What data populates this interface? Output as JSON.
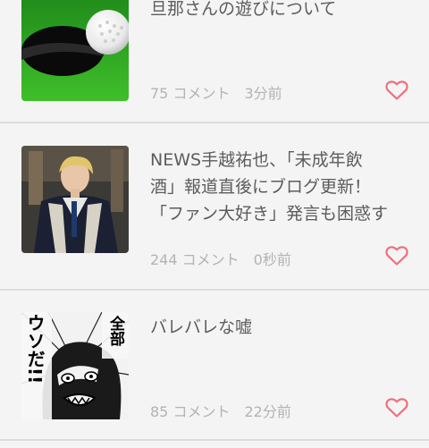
{
  "colors": {
    "background": "#f4f4f4",
    "title_text": "#5c5c5c",
    "meta_text": "#b3b3b3",
    "heart": "#ee6f7c",
    "divider": "#dcdcdc"
  },
  "articles": [
    {
      "title": "旦那さんの遊びについて",
      "comments": "75 コメント",
      "time": "3分前",
      "thumbnail": "golf-ball-on-green",
      "action_icon": "heart-icon"
    },
    {
      "title": "NEWS手越祐也、「未成年飲\n酒」報道直後にブログ更新！\n「ファン大好き」発言も困惑す",
      "comments": "244 コメント",
      "time": "0秒前",
      "thumbnail": "man-in-suit-photo",
      "action_icon": "heart-icon"
    },
    {
      "title": "バレバレな嘘",
      "comments": "85 コメント",
      "time": "22分前",
      "thumbnail": "manga-panel",
      "thumbnail_text": [
        "全部",
        "ウソだ!!"
      ],
      "action_icon": "heart-icon"
    }
  ]
}
